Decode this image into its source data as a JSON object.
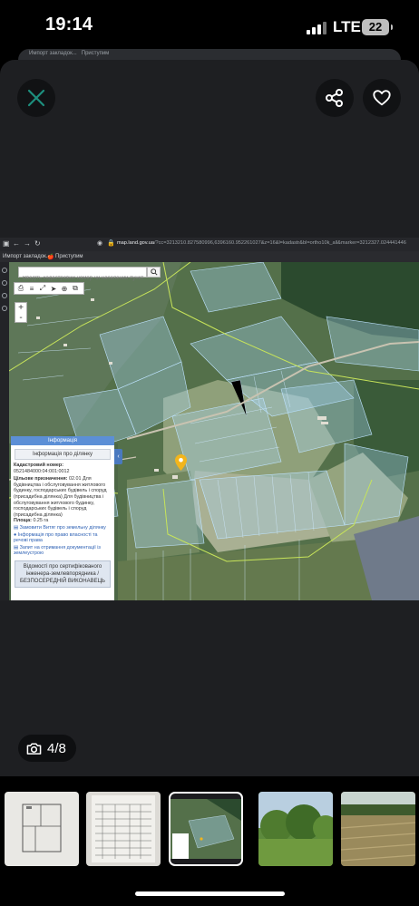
{
  "status_bar": {
    "time": "19:14",
    "network": "LTE",
    "battery": "22"
  },
  "background_sheet": {
    "bookmark_1": "Импорт закладок...",
    "bookmark_2": "Приступим"
  },
  "viewer": {
    "close_icon": "close-icon",
    "share_icon": "share-icon",
    "favorite_icon": "heart-icon",
    "photo_counter": "4/8",
    "counter_icon": "camera-icon"
  },
  "browser": {
    "url_host": "map.land.gov.ua",
    "url_rest": "/?cc=3213210.827580996,6396160.952261027&z=16&l=kadastr&bl=ortho10k_all&marker=3212327.024441446",
    "bookmarks": [
      "Импорт закладок...",
      "Приступим"
    ]
  },
  "map": {
    "search_placeholder": "Введіть кадастровий номер чи населений пункт",
    "zoom_in": "+",
    "zoom_out": "-"
  },
  "info_panel": {
    "header": "Інформація",
    "sub_button": "Інформація про ділянку",
    "cadastral_label": "Кадастровий номер:",
    "cadastral_value": "0521484000:04:001:0012",
    "purpose_label": "Цільове призначення:",
    "purpose_value": "02.01 Для будівництва і обслуговування житлового будинку, господарських будівель і споруд (присадибна ділянка) Для будівництва і обслуговування житлового будинку, господарських будівель і споруд (присадибна ділянка)",
    "area_label": "Площа:",
    "area_value": "0.25 га",
    "link_1": "Замовити Витяг про земельну ділянку",
    "link_2": "Інформація про право власності та речові права",
    "link_3": "Запит на отримання документації із землеустрою",
    "engineers_button": "Відомості про сертифікованого інженера-землевпорядника / БЕЗПОСЕРЕДНІЙ ВИКОНАВЕЦЬ"
  }
}
